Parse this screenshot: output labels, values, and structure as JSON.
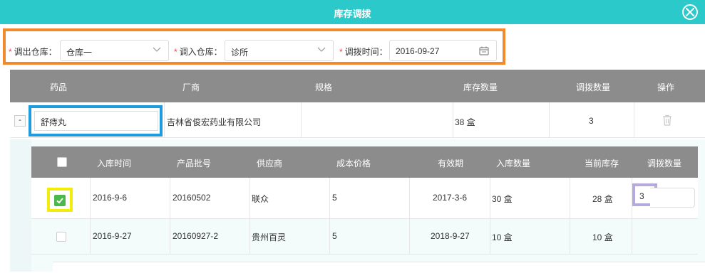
{
  "dialog": {
    "title": "库存调拨"
  },
  "filters": {
    "out_label": "调出仓库：",
    "out_value": "仓库一",
    "in_label": "调入仓库：",
    "in_value": "诊所",
    "time_label": "调拨时间：",
    "time_value": "2016-09-27",
    "required_mark": "*"
  },
  "main_table": {
    "headers": [
      "药品",
      "厂商",
      "规格",
      "库存数量",
      "调拨数量",
      "操作"
    ],
    "row": {
      "toggle": "-",
      "drug": "舒痔丸",
      "maker": "吉林省俊宏药业有限公司",
      "spec": "",
      "stock": "38 盒",
      "transfer": "3"
    }
  },
  "sub_table": {
    "headers": [
      "入库时间",
      "产品批号",
      "供应商",
      "成本价格",
      "有效期",
      "入库数量",
      "当前库存",
      "调拨数量"
    ],
    "rows": [
      {
        "checked": true,
        "in_time": "2016-9-6",
        "batch": "20160502",
        "supplier": "联众",
        "cost": "5",
        "expiry": "2017-3-6",
        "in_qty": "30 盒",
        "current": "28 盒",
        "transfer": "3"
      },
      {
        "checked": false,
        "in_time": "2016-9-27",
        "batch": "20160927-2",
        "supplier": "贵州百灵",
        "cost": "5",
        "expiry": "2018-9-27",
        "in_qty": "10 盒",
        "current": "10 盒",
        "transfer": ""
      }
    ]
  },
  "colors": {
    "titlebar": "#2bc9c9",
    "header": "#8c8c8c",
    "check_green": "#4cb84c"
  }
}
